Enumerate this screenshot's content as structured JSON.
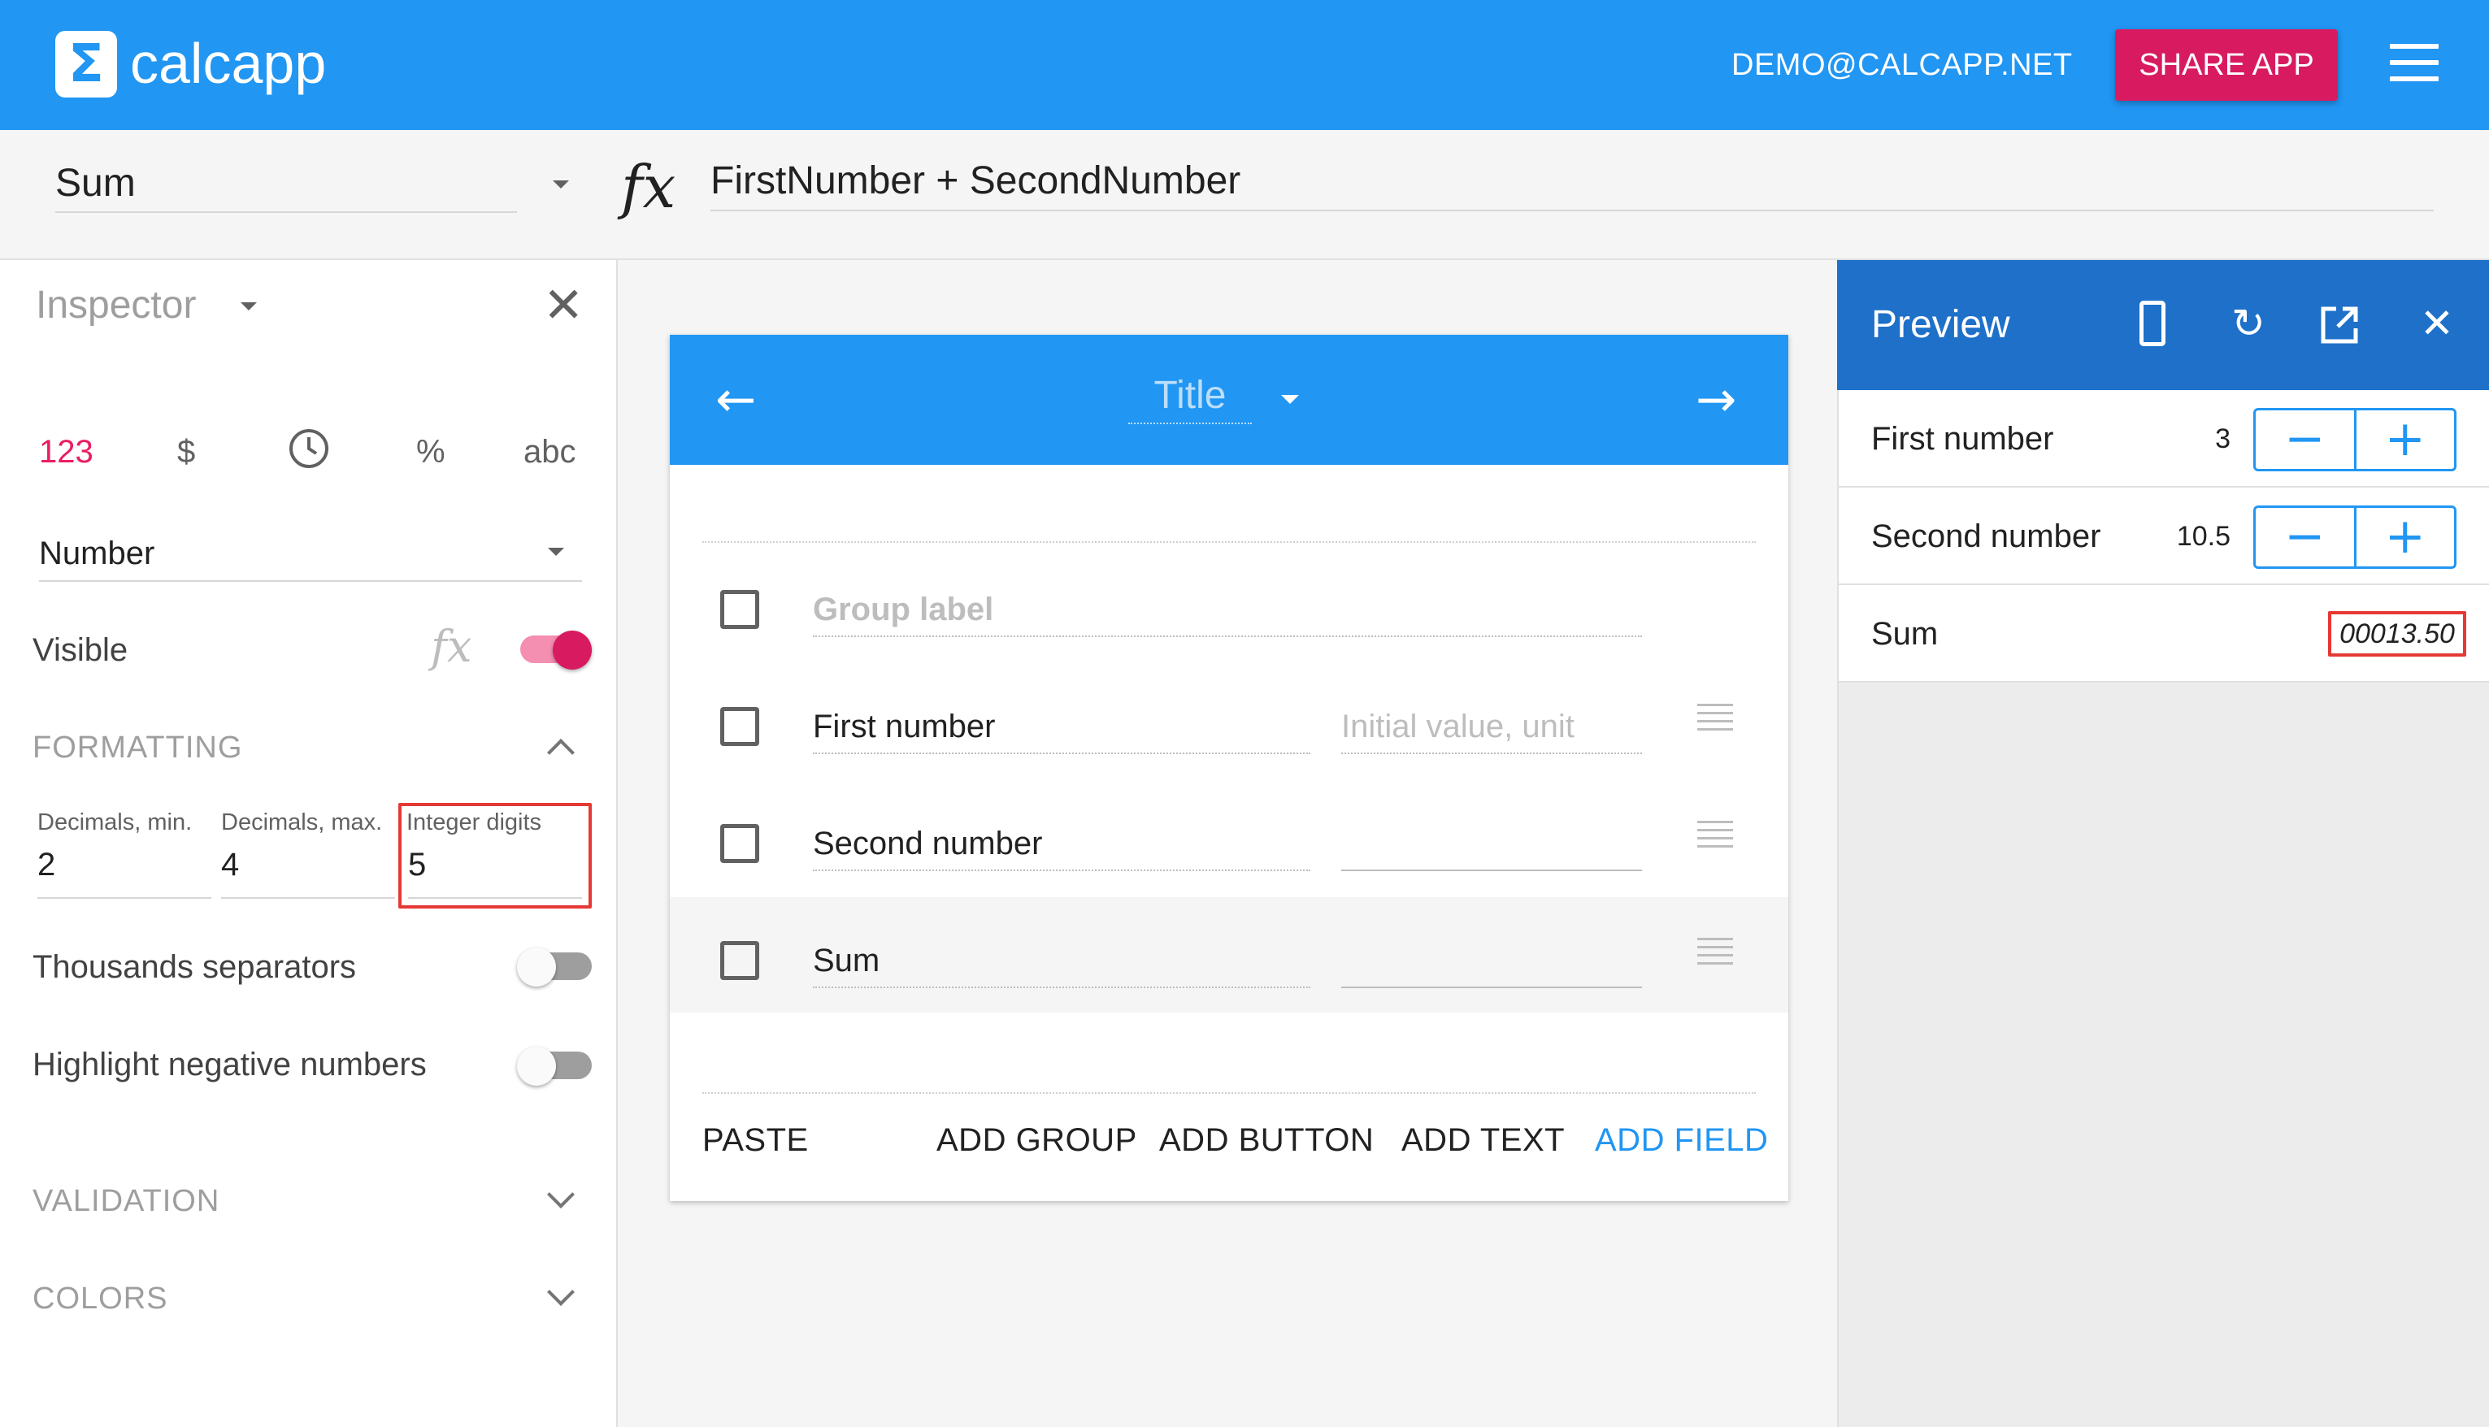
{
  "app": {
    "logo_glyph": "Σ",
    "name": "calcapp",
    "user_email": "DEMO@CALCAPP.NET",
    "share_label": "SHARE APP"
  },
  "formula_bar": {
    "selected_field": "Sum",
    "fx_symbol": "fx",
    "formula": "FirstNumber + SecondNumber"
  },
  "inspector": {
    "title": "Inspector",
    "type_tabs": [
      "123",
      "$",
      "◷",
      "%",
      "abc"
    ],
    "active_type_index": 0,
    "value_type": "Number",
    "visible_label": "Visible",
    "visible_fx": "fx",
    "visible_on": true,
    "formatting": {
      "heading": "FORMATTING",
      "decimals_min_label": "Decimals, min.",
      "decimals_min": "2",
      "decimals_max_label": "Decimals, max.",
      "decimals_max": "4",
      "integer_digits_label": "Integer digits",
      "integer_digits": "5",
      "thousands_label": "Thousands separators",
      "thousands_on": false,
      "highlight_label": "Highlight negative numbers",
      "highlight_on": false
    },
    "validation_heading": "VALIDATION",
    "colors_heading": "COLORS"
  },
  "editor": {
    "title_placeholder": "Title",
    "group_label_placeholder": "Group label",
    "rows": [
      {
        "label": "First number",
        "initial_placeholder": "Initial value, unit"
      },
      {
        "label": "Second number",
        "initial_placeholder": ""
      },
      {
        "label": "Sum",
        "initial_placeholder": ""
      }
    ],
    "footer": {
      "paste": "PASTE",
      "add_group": "ADD GROUP",
      "add_button": "ADD BUTTON",
      "add_text": "ADD TEXT",
      "add_field": "ADD FIELD"
    }
  },
  "preview": {
    "title": "Preview",
    "rows": [
      {
        "label": "First number",
        "value": "3"
      },
      {
        "label": "Second number",
        "value": "10.5"
      },
      {
        "label": "Sum",
        "value": "00013.50"
      }
    ]
  },
  "colors": {
    "primary": "#2196f3",
    "preview_header": "#1e70c9",
    "accent": "#d81b60",
    "highlight": "#e53935"
  }
}
